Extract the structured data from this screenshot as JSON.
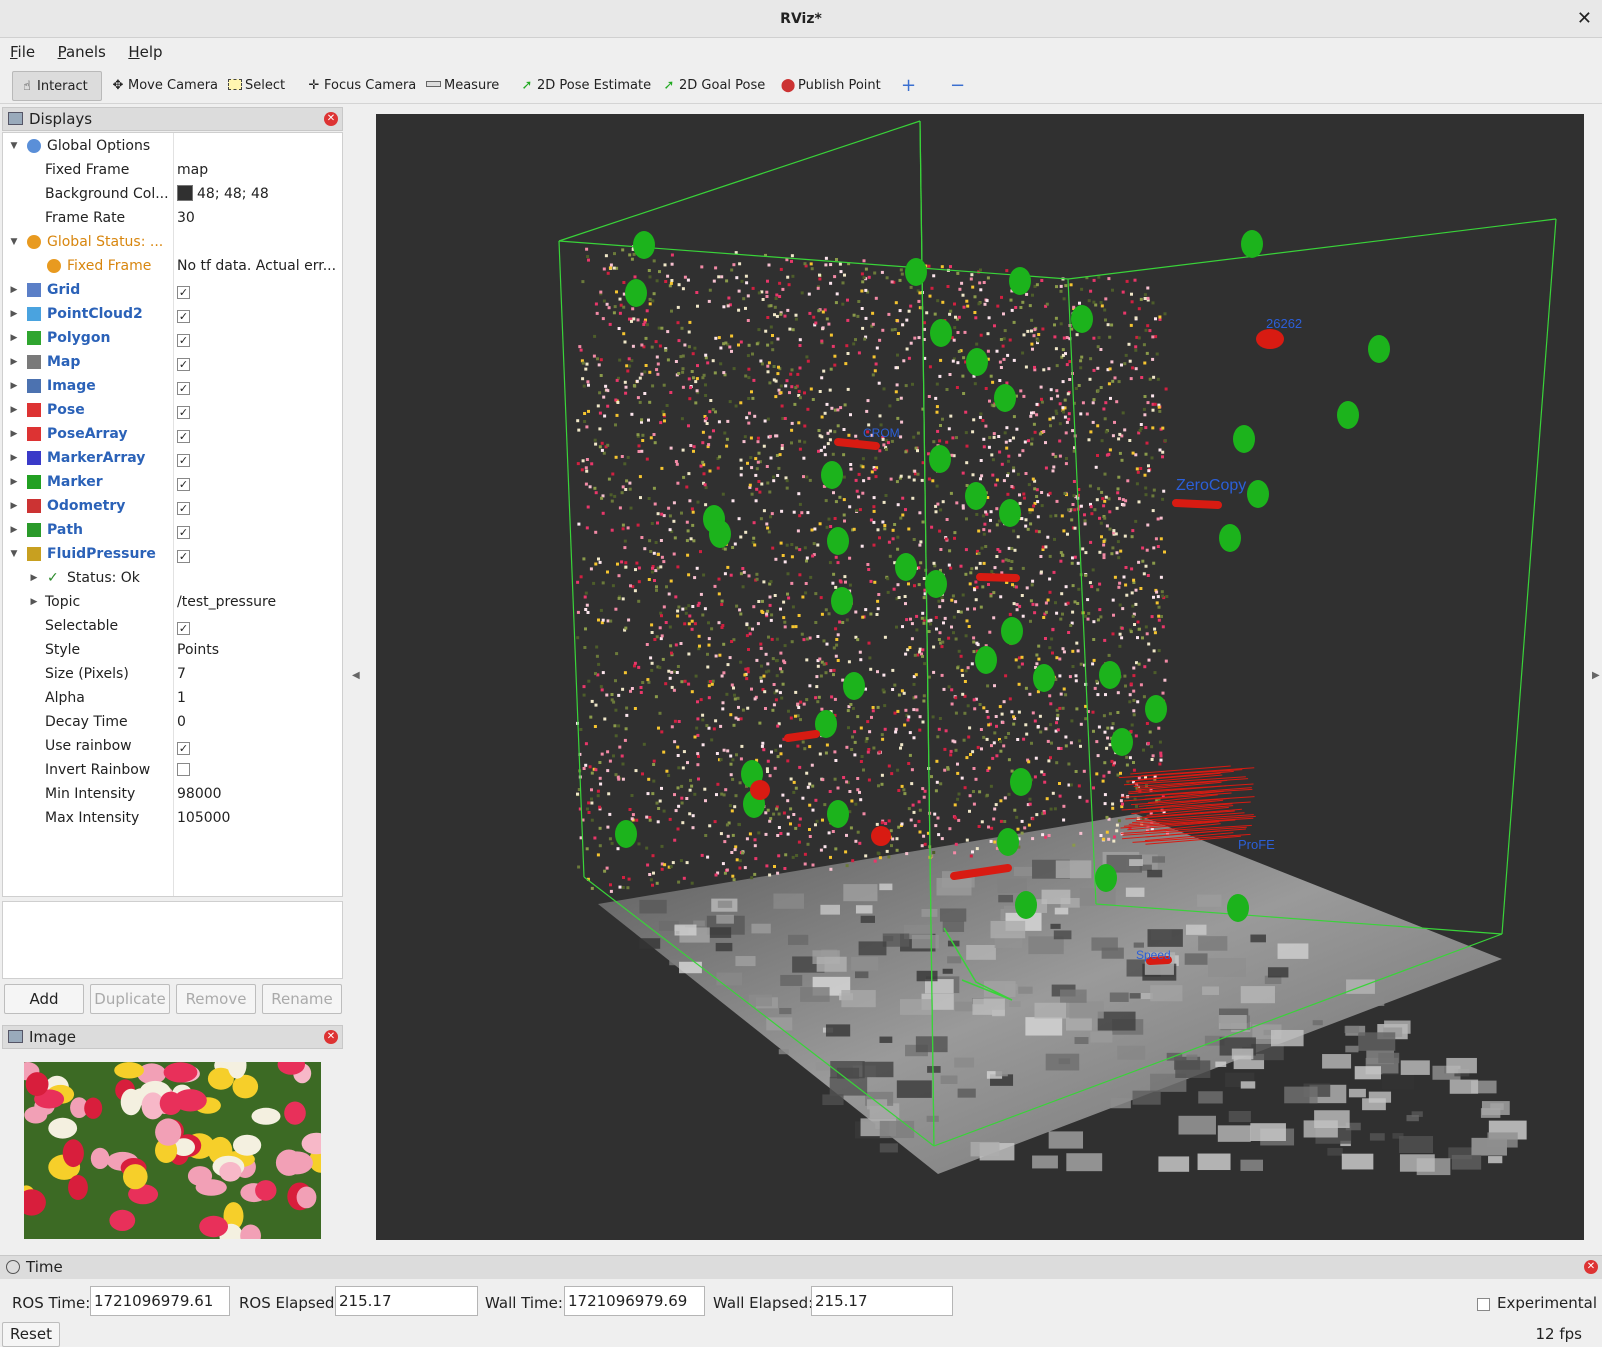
{
  "window": {
    "title": "RViz*"
  },
  "menu": [
    "File",
    "Panels",
    "Help"
  ],
  "toolbar": {
    "interact": "Interact",
    "move_camera": "Move Camera",
    "select": "Select",
    "focus_camera": "Focus Camera",
    "measure": "Measure",
    "pose_estimate": "2D Pose Estimate",
    "goal_pose": "2D Goal Pose",
    "publish_point": "Publish Point"
  },
  "displays": {
    "title": "Displays",
    "global_options": "Global Options",
    "fixed_frame_label": "Fixed Frame",
    "fixed_frame_value": "map",
    "background_label": "Background Col...",
    "background_value": "48; 48; 48",
    "frame_rate_label": "Frame Rate",
    "frame_rate_value": "30",
    "global_status": "Global Status: ...",
    "status_fixed_frame": "Fixed Frame",
    "status_fixed_frame_value": "No tf data.  Actual err...",
    "items": [
      "Grid",
      "PointCloud2",
      "Polygon",
      "Map",
      "Image",
      "Pose",
      "PoseArray",
      "MarkerArray",
      "Marker",
      "Odometry",
      "Path",
      "FluidPressure"
    ],
    "fluid": {
      "status": "Status: Ok",
      "topic_label": "Topic",
      "topic_value": "/test_pressure",
      "selectable_label": "Selectable",
      "style_label": "Style",
      "style_value": "Points",
      "size_label": "Size (Pixels)",
      "size_value": "7",
      "alpha_label": "Alpha",
      "alpha_value": "1",
      "decay_label": "Decay Time",
      "decay_value": "0",
      "rainbow_label": "Use rainbow",
      "invert_label": "Invert Rainbow",
      "min_label": "Min Intensity",
      "min_value": "98000",
      "max_label": "Max Intensity",
      "max_value": "105000"
    },
    "buttons": {
      "add": "Add",
      "duplicate": "Duplicate",
      "remove": "Remove",
      "rename": "Rename"
    }
  },
  "image_panel": {
    "title": "Image"
  },
  "viewport": {
    "labels": {
      "l1": "26262",
      "l2": "ZeroCopy",
      "l3": "CROM",
      "l4": "Speed",
      "l5": "ProFE"
    }
  },
  "time": {
    "title": "Time",
    "ros_time_label": "ROS Time:",
    "ros_time": "1721096979.61",
    "ros_elapsed_label": "ROS Elapsed:",
    "ros_elapsed": "215.17",
    "wall_time_label": "Wall Time:",
    "wall_time": "1721096979.69",
    "wall_elapsed_label": "Wall Elapsed:",
    "wall_elapsed": "215.17",
    "experimental": "Experimental",
    "reset": "Reset",
    "fps": "12 fps"
  },
  "colors": {
    "background": "#303030",
    "accent": "#2b62b8",
    "bbox": "#39d339",
    "marker_green": "#1cb31c",
    "marker_red": "#d81b12"
  }
}
